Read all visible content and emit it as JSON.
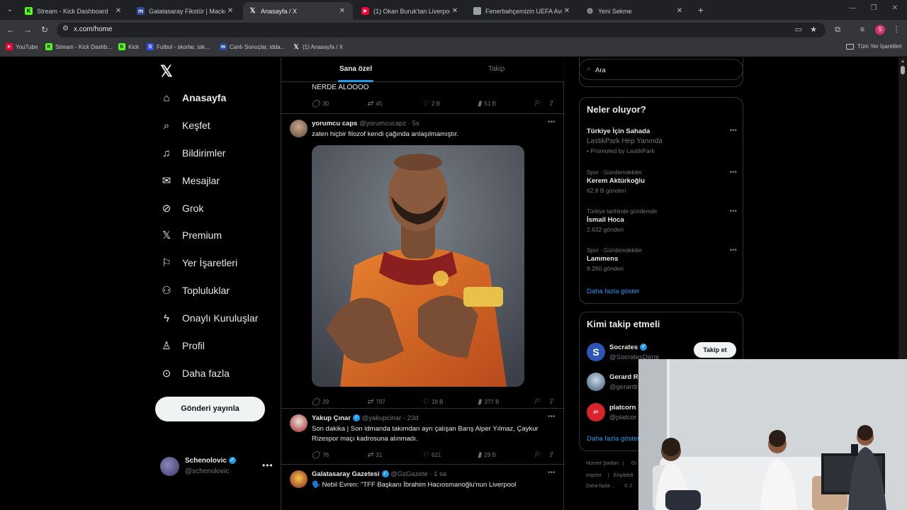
{
  "browser": {
    "tabs": [
      {
        "title": "Stream - Kick Dashboard",
        "favicon": "kick-icon",
        "active": false
      },
      {
        "title": "Galatasaray Fikstür | Mackolik.c",
        "favicon": "mackolik-icon",
        "active": false
      },
      {
        "title": "Anasayfa / X",
        "favicon": "x-icon",
        "active": true
      },
      {
        "title": "(1) Okan Buruk'tan Liverpool'a",
        "favicon": "youtube-icon",
        "active": false
      },
      {
        "title": "Fenerbahçemizin UEFA Avrupa",
        "favicon": "news-icon",
        "active": false
      },
      {
        "title": "Yeni Sekme",
        "favicon": "globe-icon",
        "active": false
      }
    ],
    "url": "x.com/home",
    "profile_initial": "S",
    "bookmarks": [
      {
        "label": "YouTube",
        "icon": "youtube-icon"
      },
      {
        "label": "Stream - Kick Dashb...",
        "icon": "kick-icon"
      },
      {
        "label": "Kick",
        "icon": "kick-icon"
      },
      {
        "label": "Futbol - skorlar, tak...",
        "icon": "sofascore-icon"
      },
      {
        "label": "Canlı Sonuçlar, idda...",
        "icon": "mackolik-icon"
      },
      {
        "label": "(1) Anasayfa / X",
        "icon": "x-icon"
      }
    ],
    "all_bookmarks": "Tüm Yer İşaretleri"
  },
  "nav": {
    "items": [
      {
        "label": "Anasayfa",
        "icon": "home-icon"
      },
      {
        "label": "Keşfet",
        "icon": "search-icon"
      },
      {
        "label": "Bildirimler",
        "icon": "bell-icon"
      },
      {
        "label": "Mesajlar",
        "icon": "mail-icon"
      },
      {
        "label": "Grok",
        "icon": "grok-icon"
      },
      {
        "label": "Premium",
        "icon": "x-icon"
      },
      {
        "label": "Yer İşaretleri",
        "icon": "bookmark-icon"
      },
      {
        "label": "Topluluklar",
        "icon": "communities-icon"
      },
      {
        "label": "Onaylı Kuruluşlar",
        "icon": "lightning-icon"
      },
      {
        "label": "Profil",
        "icon": "person-icon"
      },
      {
        "label": "Daha fazla",
        "icon": "more-circle-icon"
      }
    ],
    "post_button": "Gönderi yayınla",
    "account": {
      "name": "Schenolovic",
      "handle": "@schenolovic"
    }
  },
  "feed": {
    "tabs": [
      "Sana özel",
      "Takip"
    ],
    "prev_tweet": {
      "text": "NERDE ALOOOO",
      "replies": "30",
      "reposts": "45",
      "likes": "2 B",
      "views": "51 B"
    },
    "tweets": [
      {
        "name": "yorumcu caps",
        "handle": "@yorumcucapz",
        "time": "5s",
        "verified": false,
        "text": "zaten hiçbir filozof kendi çağında anlaşılmamıştır.",
        "replies": "29",
        "reposts": "797",
        "likes": "18 B",
        "views": "377 B",
        "has_media": true
      },
      {
        "name": "Yakup Çınar",
        "handle": "@yakupcinar",
        "time": "23d",
        "verified": true,
        "text": "Son dakika | Son idmanda takımdan ayrı çalışan Barış Alper Yılmaz, Çaykur Rizespor maçı kadrosuna alınmadı.",
        "replies": "76",
        "reposts": "31",
        "likes": "621",
        "views": "29 B"
      },
      {
        "name": "Galatasaray Gazetesi",
        "handle": "@GsGazete",
        "time": "1 sa",
        "verified": true,
        "text": "🗣️ Nebil Evren: \"TFF Başkanı İbrahim Hacıosmanoğlu'nun Liverpool"
      }
    ]
  },
  "right": {
    "search_placeholder": "Ara",
    "trends_title": "Neler oluyor?",
    "promo": {
      "title": "Türkiye İçin Sahada",
      "subtitle": "LastikPark Hep Yanında",
      "promoted": "Promoted by LastikPark"
    },
    "trends": [
      {
        "context": "Spor · Gündemdekiler",
        "name": "Kerem Aktürkoğlu",
        "count": "62,8 B gönderi"
      },
      {
        "context": "Türkiye tarihinde gündemde",
        "name": "İsmail Hoca",
        "count": "2.632 gönderi"
      },
      {
        "context": "Spor · Gündemdekiler",
        "name": "Lammens",
        "count": "9.260 gönderi"
      }
    ],
    "show_more": "Daha fazla göster",
    "who_title": "Kimi takip etmeli",
    "who": [
      {
        "name": "Socrates",
        "handle": "@SocratesDergi",
        "verified": true
      },
      {
        "name": "Gerard R",
        "handle": "@gerardr"
      },
      {
        "name": "platcorn",
        "handle": "@platcor"
      }
    ],
    "follow_label": "Takip et",
    "footer": [
      "Hizmet Şartları",
      "Gi",
      "Imprint",
      "Erişilebili",
      "Daha fazla ...",
      "© 2"
    ]
  }
}
